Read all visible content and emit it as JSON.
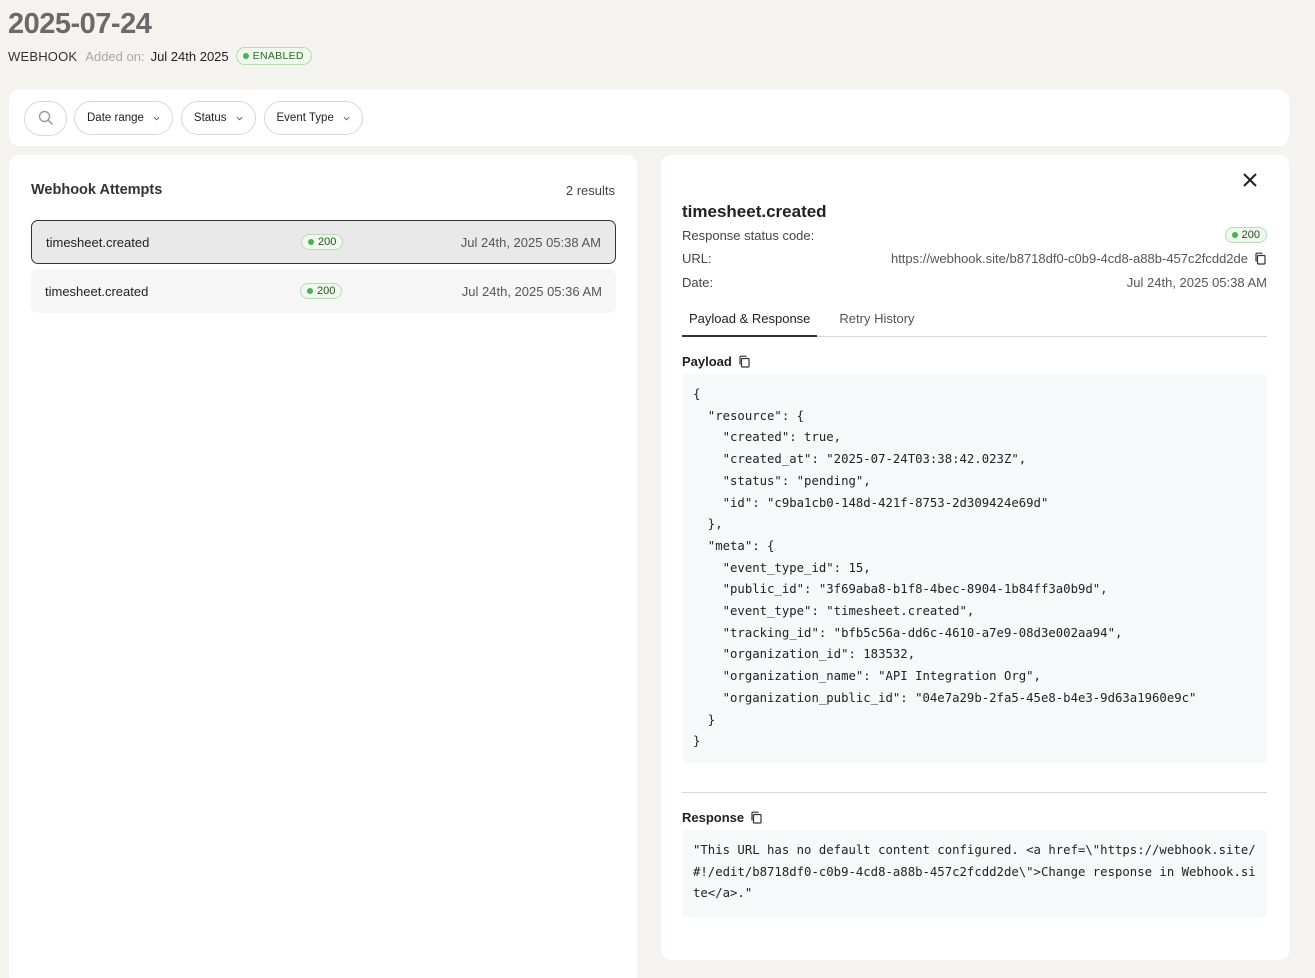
{
  "header": {
    "title": "2025-07-24",
    "type": "WEBHOOK",
    "added_label": "Added on:",
    "added_value": "Jul 24th 2025",
    "status": "ENABLED"
  },
  "filters": {
    "date_range": "Date range",
    "status": "Status",
    "event_type": "Event Type"
  },
  "attempts": {
    "title": "Webhook Attempts",
    "count": "2 results",
    "rows": [
      {
        "event": "timesheet.created",
        "code": "200",
        "date": "Jul 24th, 2025 05:38 AM"
      },
      {
        "event": "timesheet.created",
        "code": "200",
        "date": "Jul 24th, 2025 05:36 AM"
      }
    ]
  },
  "detail": {
    "title": "timesheet.created",
    "status_label": "Response status code:",
    "status_code": "200",
    "url_label": "URL:",
    "url_value": "https://webhook.site/b8718df0-c0b9-4cd8-a88b-457c2fcdd2de",
    "date_label": "Date:",
    "date_value": "Jul 24th, 2025 05:38 AM",
    "tabs": [
      "Payload & Response",
      "Retry History"
    ],
    "payload_label": "Payload",
    "payload": "{\n  \"resource\": {\n    \"created\": true,\n    \"created_at\": \"2025-07-24T03:38:42.023Z\",\n    \"status\": \"pending\",\n    \"id\": \"c9ba1cb0-148d-421f-8753-2d309424e69d\"\n  },\n  \"meta\": {\n    \"event_type_id\": 15,\n    \"public_id\": \"3f69aba8-b1f8-4bec-8904-1b84ff3a0b9d\",\n    \"event_type\": \"timesheet.created\",\n    \"tracking_id\": \"bfb5c56a-dd6c-4610-a7e9-08d3e002aa94\",\n    \"organization_id\": 183532,\n    \"organization_name\": \"API Integration Org\",\n    \"organization_public_id\": \"04e7a29b-2fa5-45e8-b4e3-9d63a1960e9c\"\n  }\n}",
    "response_label": "Response",
    "response": "\"This URL has no default content configured. <a href=\\\"https://webhook.site/#!/edit/b8718df0-c0b9-4cd8-a88b-457c2fcdd2de\\\">Change response in Webhook.site</a>.\""
  },
  "colors": {
    "background": "#f4f3f0",
    "success_badge_bg": "#eef8ec",
    "success_dot": "#4caf50"
  }
}
